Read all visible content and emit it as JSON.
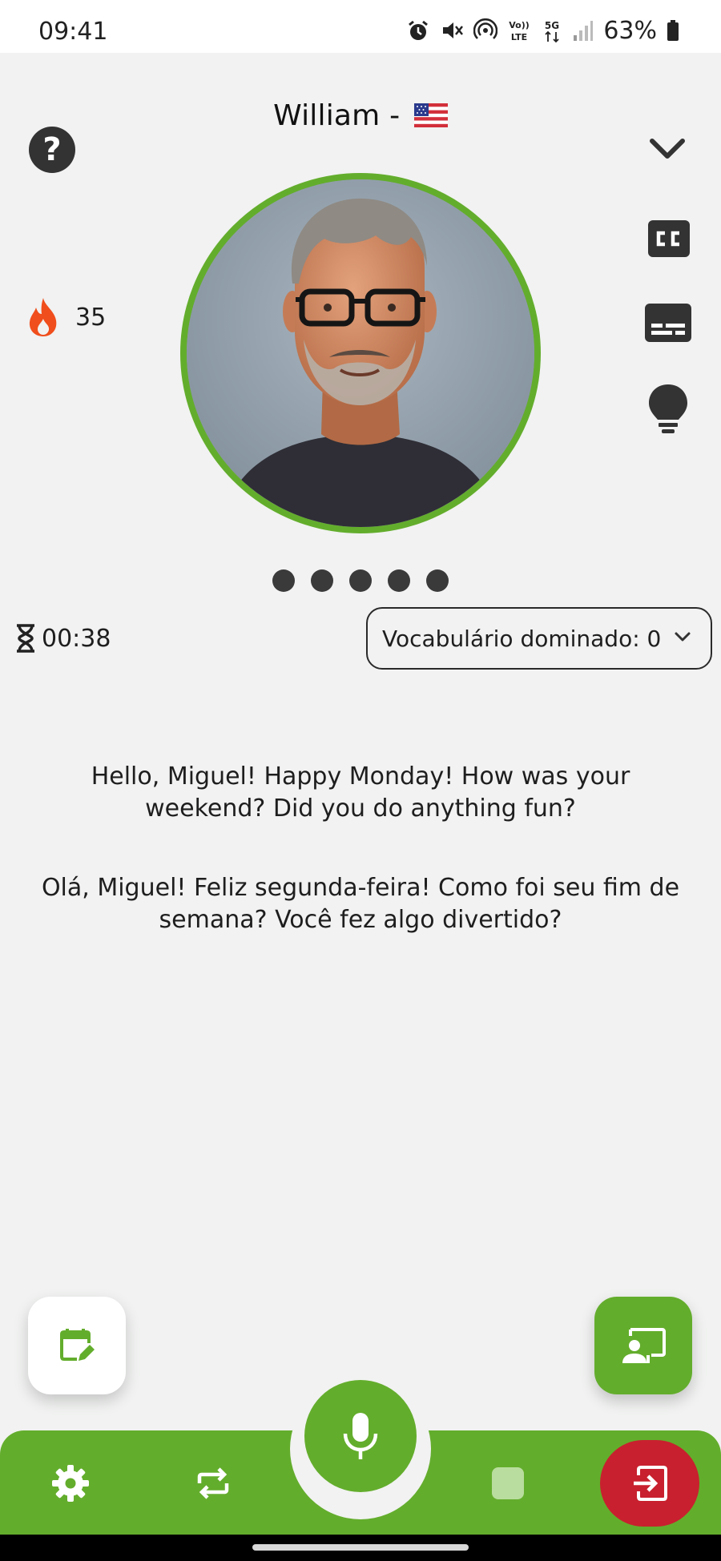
{
  "status_bar": {
    "time": "09:41",
    "signal_labels": {
      "volte": "Vo)) LTE",
      "network": "5G"
    },
    "battery": "63%",
    "icons": [
      "alarm-icon",
      "mute-icon",
      "hotspot-icon",
      "volte-icon",
      "5g-icon",
      "signal-icon",
      "battery-icon"
    ]
  },
  "header": {
    "companion_name": "William -",
    "flag": "us-flag-icon"
  },
  "side_icons": {
    "left": [
      "help-icon",
      "flame-icon"
    ],
    "right": [
      "chevron-down-icon",
      "closed-captions-icon",
      "subtitles-icon",
      "lightbulb-icon"
    ]
  },
  "help_label": "?",
  "streak": {
    "count": "35"
  },
  "pager": {
    "dots": 5
  },
  "timer": {
    "value": "00:38"
  },
  "vocab": {
    "label": "Vocabulário dominado: 0"
  },
  "messages": {
    "english": "Hello, Miguel! Happy Monday! How was your weekend? Did you do anything fun?",
    "portuguese": "Olá, Miguel! Feliz segunda-feira! Como foi seu fim de semana? Você fez algo divertido?"
  },
  "bottom_bar": {
    "icons": [
      "gear-icon",
      "repeat-icon",
      "microphone-icon",
      "stop-icon",
      "exit-icon"
    ]
  },
  "floating": {
    "left": "calendar-edit-icon",
    "right": "presenter-icon"
  },
  "colors": {
    "accent": "#63ad2c",
    "danger": "#c8202e",
    "background": "#f1f2f1",
    "streak": "#f04e1c"
  }
}
